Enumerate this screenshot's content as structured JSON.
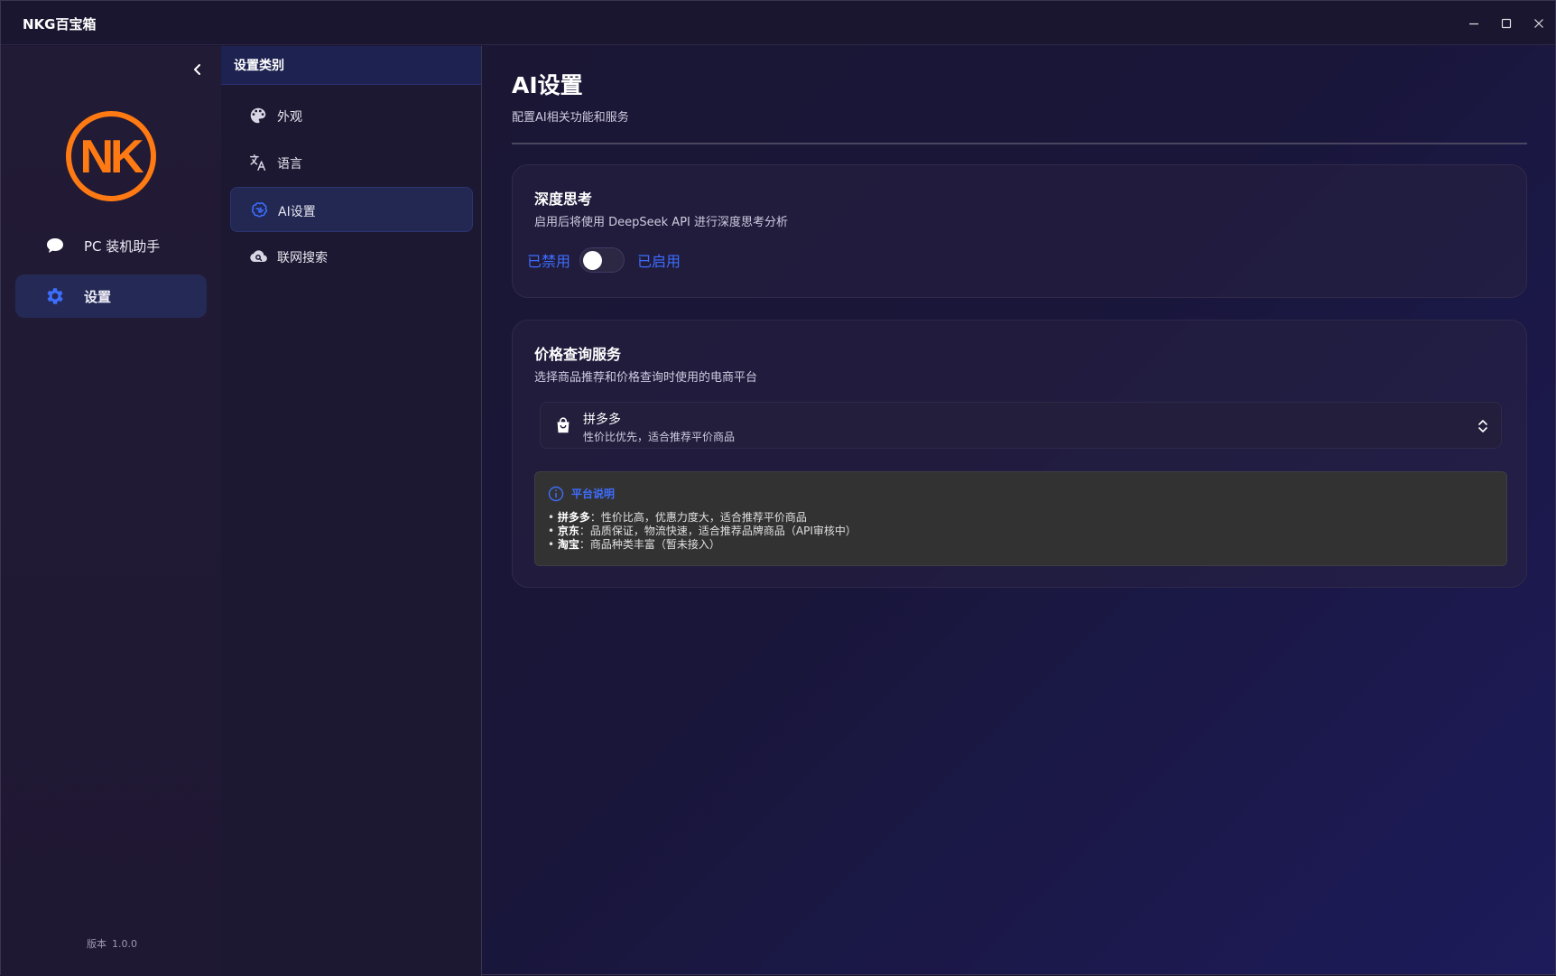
{
  "window": {
    "title": "NKG百宝箱"
  },
  "sidebar": {
    "logo_text": "NK",
    "items": [
      {
        "label": "PC 装机助手",
        "icon": "chat-bubble-icon"
      },
      {
        "label": "设置",
        "icon": "gear-icon",
        "active": true
      }
    ],
    "version_label": "版本",
    "version_value": "1.0.0"
  },
  "categories": {
    "header": "设置类别",
    "items": [
      {
        "label": "外观",
        "icon": "palette-icon"
      },
      {
        "label": "语言",
        "icon": "translate-icon"
      },
      {
        "label": "AI设置",
        "icon": "brain-icon",
        "active": true
      },
      {
        "label": "联网搜索",
        "icon": "cloud-search-icon"
      }
    ]
  },
  "main": {
    "title": "AI设置",
    "subtitle": "配置AI相关功能和服务",
    "deep_think": {
      "title": "深度思考",
      "desc": "启用后将使用 DeepSeek API 进行深度思考分析",
      "off_label": "已禁用",
      "on_label": "已启用",
      "enabled": false
    },
    "price_service": {
      "title": "价格查询服务",
      "desc": "选择商品推荐和价格查询时使用的电商平台",
      "selected_title": "拼多多",
      "selected_desc": "性价比优先，适合推荐平价商品",
      "info_title": "平台说明",
      "info_items": [
        {
          "name": "拼多多",
          "text": "：性价比高，优惠力度大，适合推荐平价商品"
        },
        {
          "name": "京东",
          "text": "：品质保证，物流快速，适合推荐品牌商品（API审核中）"
        },
        {
          "name": "淘宝",
          "text": "：商品种类丰富（暂未接入）"
        }
      ]
    }
  },
  "colors": {
    "accent": "#3d6dff",
    "logo_orange": "#ff7a12",
    "active_bg": "#242a55"
  }
}
